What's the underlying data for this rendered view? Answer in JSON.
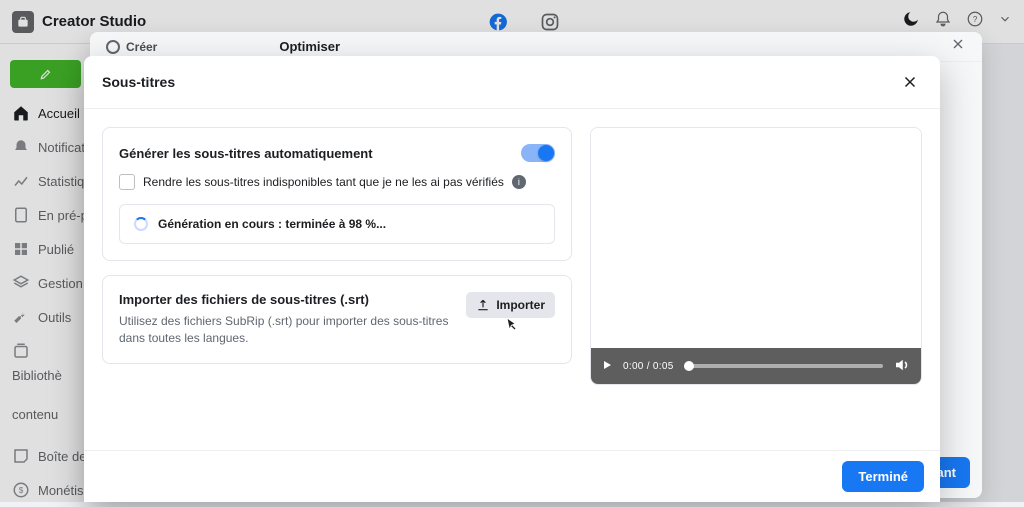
{
  "topbar": {
    "brand": "Creator Studio"
  },
  "sidebar": {
    "items": [
      {
        "label": "Accueil"
      },
      {
        "label": "Notificat"
      },
      {
        "label": "Statistiqu"
      },
      {
        "label": "En pré-p"
      },
      {
        "label": "Publié"
      },
      {
        "label": "Gestion"
      },
      {
        "label": "Outils"
      },
      {
        "label": "Bibliothè"
      },
      {
        "label2": "contenu"
      },
      {
        "label": "Boîte de"
      },
      {
        "label": "Monétis"
      }
    ]
  },
  "back_modal": {
    "step1": "Créer",
    "title": "Optimiser",
    "next": "vant"
  },
  "front": {
    "title": "Sous-titres",
    "auto": {
      "heading": "Générer les sous-titres automatiquement",
      "toggle_on": true,
      "pending_label": "Rendre les sous-titres indisponibles tant que je ne les ai pas vérifiés",
      "progress": "Génération en cours : terminée à 98 %..."
    },
    "import": {
      "heading": "Importer des fichiers de sous-titres (.srt)",
      "desc": "Utilisez des fichiers SubRip (.srt) pour importer des sous-titres dans toutes les langues.",
      "button": "Importer"
    },
    "video": {
      "time": "0:00 / 0:05"
    },
    "done": "Terminé"
  }
}
